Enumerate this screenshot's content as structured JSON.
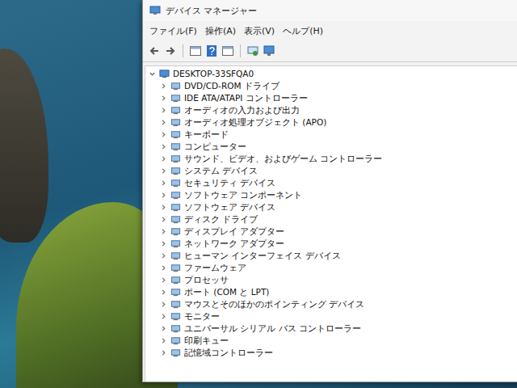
{
  "window": {
    "title": "デバイス マネージャー"
  },
  "menu": [
    "ファイル(F)",
    "操作(A)",
    "表示(V)",
    "ヘルプ(H)"
  ],
  "tree": {
    "root": {
      "label": "DESKTOP-33SFQA0",
      "expanded": true
    },
    "items": [
      {
        "label": "DVD/CD-ROM ドライブ",
        "expanded": false
      },
      {
        "label": "IDE ATA/ATAPI コントローラー",
        "expanded": false
      },
      {
        "label": "オーディオの入力および出力",
        "expanded": false
      },
      {
        "label": "オーディオ処理オブジェクト (APO)",
        "expanded": false
      },
      {
        "label": "キーボード",
        "expanded": false
      },
      {
        "label": "コンピューター",
        "expanded": false
      },
      {
        "label": "サウンド、ビデオ、およびゲーム コントローラー",
        "expanded": false
      },
      {
        "label": "システム デバイス",
        "expanded": false
      },
      {
        "label": "セキュリティ デバイス",
        "expanded": false
      },
      {
        "label": "ソフトウェア コンポーネント",
        "expanded": false
      },
      {
        "label": "ソフトウェア デバイス",
        "expanded": false
      },
      {
        "label": "ディスク ドライブ",
        "expanded": false
      },
      {
        "label": "ディスプレイ アダプター",
        "expanded": false
      },
      {
        "label": "ネットワーク アダプター",
        "expanded": false
      },
      {
        "label": "ヒューマン インターフェイス デバイス",
        "expanded": false
      },
      {
        "label": "ファームウェア",
        "expanded": false
      },
      {
        "label": "プロセッサ",
        "expanded": false
      },
      {
        "label": "ポート (COM と LPT)",
        "expanded": false
      },
      {
        "label": "マウスとそのほかのポインティング デバイス",
        "expanded": false
      },
      {
        "label": "モニター",
        "expanded": false
      },
      {
        "label": "ユニバーサル シリアル バス コントローラー",
        "expanded": false
      },
      {
        "label": "印刷キュー",
        "expanded": false
      },
      {
        "label": "記憶域コントローラー",
        "expanded": false
      }
    ]
  }
}
